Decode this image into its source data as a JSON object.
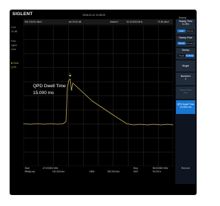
{
  "brand": "SIGLENT",
  "datetime": "2016-01-12  11:28:20",
  "menu_title": "Sweep",
  "topbar": {
    "ref": "Ref  106.90 dBuV",
    "att": "Att  20.00 dB",
    "marker_label": "Marker1",
    "marker_freq": "50.124000 MHz",
    "marker_amp": "79.38 dBuV"
  },
  "left_column": {
    "log": "LOG",
    "scale": "10 dB",
    "free": "Free",
    "lgavg": "LgAvr",
    "cont": "Cont",
    "clear": "■ Clear",
    "qpk": "Q-Pk"
  },
  "overlay": {
    "title": "QPD Dwell Time",
    "value": "15.000 ms"
  },
  "bottom": {
    "start": "Start",
    "start_value": "47.000000 MHz",
    "stop": "Stop",
    "stop_value": "55.000000 MHz",
    "rbw": "RBW(Lsb)",
    "rbw_value": "120.000 kHz",
    "vbw": "VBW",
    "vbw_value": "300.000 kHz",
    "swt": "SWT",
    "swt_value": "93.220 s"
  },
  "panel": {
    "sweep_time_title": "Sweep Time",
    "sweep_time_value": "11.28 s",
    "sweep_time_opts": [
      "Auto",
      "Manual"
    ],
    "sweep_rule_title": "Sweep Rule",
    "sweep_rule_opts": [
      "Speed",
      "Accuracy"
    ],
    "sweep_title": "Sweep",
    "sweep_opts": [
      "Single",
      "Continue"
    ],
    "single_label": "Single",
    "numbers_label": "Numbers",
    "numbers_value": "1",
    "sweep_mode_label": "Sweep Mode",
    "sweep_mode_value": "Auto",
    "qpd_title": "QPD Dwell Time",
    "qpd_value": "15.000 ms",
    "remote_label": "Remote"
  },
  "colors": {
    "trace": "#c8b45a",
    "grid": "#3a3a3a",
    "accent": "#1976d2",
    "panel": "#202c3a"
  }
}
